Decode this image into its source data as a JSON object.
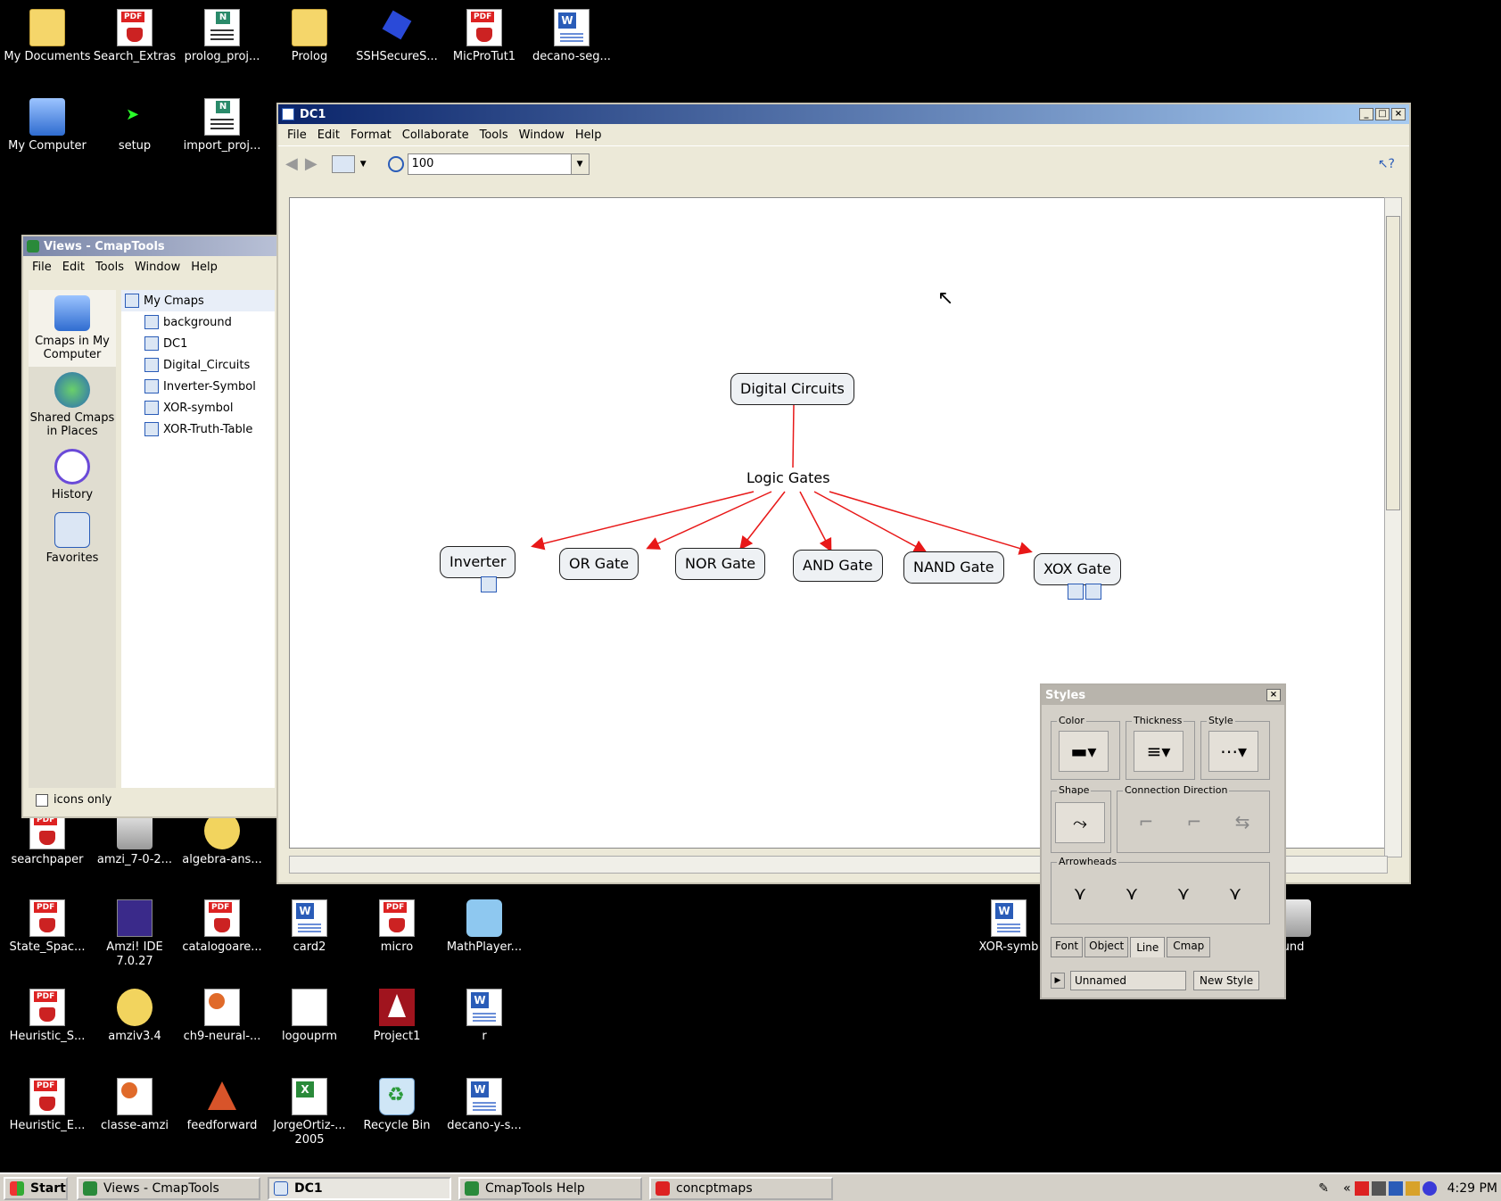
{
  "desktop_icons": [
    {
      "label": "My Documents",
      "icon": "ic-folder"
    },
    {
      "label": "Search_Extras",
      "icon": "ic-pdf"
    },
    {
      "label": "prolog_proj...",
      "icon": "ic-note"
    },
    {
      "label": "Prolog",
      "icon": "ic-folder"
    },
    {
      "label": "SSHSecureS...",
      "icon": "ic-ssh"
    },
    {
      "label": "MicProTut1",
      "icon": "ic-pdf"
    },
    {
      "label": "decano-seg...",
      "icon": "ic-word"
    },
    {
      "label": "My Computer",
      "icon": "ic-comp"
    },
    {
      "label": "setup",
      "icon": "ic-green-arrow"
    },
    {
      "label": "import_proj...",
      "icon": "ic-note"
    },
    {
      "label": "searchpaper",
      "icon": "ic-pdf"
    },
    {
      "label": "amzi_7-0-2...",
      "icon": "ic-generic"
    },
    {
      "label": "algebra-ans...",
      "icon": "ic-zip"
    },
    {
      "label": "State_Spac...",
      "icon": "ic-pdf"
    },
    {
      "label": "Amzi! IDE 7.0.27",
      "icon": "ic-amzi"
    },
    {
      "label": "catalogoare...",
      "icon": "ic-pdf"
    },
    {
      "label": "card2",
      "icon": "ic-word"
    },
    {
      "label": "micro",
      "icon": "ic-pdf"
    },
    {
      "label": "MathPlayer...",
      "icon": "ic-math"
    },
    {
      "label": "XOR-symb",
      "icon": "ic-word"
    },
    {
      "label": "und",
      "icon": "ic-generic"
    },
    {
      "label": "Heuristic_S...",
      "icon": "ic-pdf"
    },
    {
      "label": "amziv3.4",
      "icon": "ic-zip"
    },
    {
      "label": "ch9-neural-...",
      "icon": "ic-ppt"
    },
    {
      "label": "logouprm",
      "icon": "ic-logo"
    },
    {
      "label": "Project1",
      "icon": "ic-red"
    },
    {
      "label": "r",
      "icon": "ic-word"
    },
    {
      "label": "Heuristic_E...",
      "icon": "ic-pdf"
    },
    {
      "label": "classe-amzi",
      "icon": "ic-ppt"
    },
    {
      "label": "feedforward",
      "icon": "ic-matlab"
    },
    {
      "label": "JorgeOrtiz-... 2005",
      "icon": "ic-excel"
    },
    {
      "label": "Recycle Bin",
      "icon": "ic-recycle"
    },
    {
      "label": "decano-y-s...",
      "icon": "ic-word"
    }
  ],
  "dc1": {
    "title": "DC1",
    "menu": [
      "File",
      "Edit",
      "Format",
      "Collaborate",
      "Tools",
      "Window",
      "Help"
    ],
    "zoom": "100",
    "map": {
      "root": "Digital Circuits",
      "linking_phrase": "Logic Gates",
      "children": [
        "Inverter",
        "OR Gate",
        "NOR Gate",
        "AND Gate",
        "NAND Gate",
        "XOX Gate"
      ]
    }
  },
  "views": {
    "title": "Views - CmapTools",
    "menu": [
      "File",
      "Edit",
      "Tools",
      "Window",
      "Help"
    ],
    "nav": [
      "Cmaps in My Computer",
      "Shared Cmaps in Places",
      "History",
      "Favorites"
    ],
    "tree_root": "My Cmaps",
    "tree_items": [
      "background",
      "DC1",
      "Digital_Circuits",
      "Inverter-Symbol",
      "XOR-symbol",
      "XOR-Truth-Table"
    ],
    "icons_only": "icons only"
  },
  "styles": {
    "title": "Styles",
    "groups": {
      "color": "Color",
      "thickness": "Thickness",
      "style": "Style",
      "shape": "Shape",
      "direction": "Connection Direction",
      "arrowheads": "Arrowheads"
    },
    "tabs": [
      "Font",
      "Object",
      "Line",
      "Cmap"
    ],
    "style_name": "Unnamed",
    "new_style": "New Style"
  },
  "taskbar": {
    "start": "Start",
    "tasks": [
      "Views - CmapTools",
      "DC1",
      "CmapTools Help",
      "concptmaps"
    ],
    "clock": "4:29 PM"
  },
  "colors": {
    "link": "#e81818",
    "titlebar_active": "#0a246a"
  }
}
